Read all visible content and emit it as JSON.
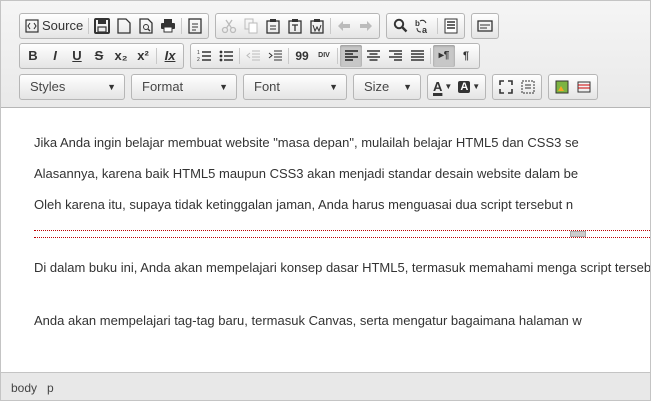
{
  "toolbar": {
    "source_label": "Source",
    "styles_label": "Styles",
    "format_label": "Format",
    "font_label": "Font",
    "size_label": "Size",
    "glyphs": {
      "bold": "B",
      "italic": "I",
      "underline": "U",
      "strike": "S",
      "subscript": "x₂",
      "superscript": "x²",
      "remove_format": "Ix",
      "blockquote": "99",
      "div": "DIV",
      "text_color": "A",
      "bg_color": "A",
      "ltr": "▸¶",
      "rtl": "¶"
    }
  },
  "content": {
    "paragraphs": [
      "Jika Anda ingin belajar membuat website \"masa depan\", mulailah belajar HTML5 dan CSS3 se",
      "Alasannya, karena baik HTML5 maupun CSS3 akan menjadi standar desain website dalam be",
      "Oleh karena itu, supaya tidak ketinggalan jaman, Anda harus menguasai dua script tersebut n",
      "Di dalam buku ini, Anda akan mempelajari konsep dasar HTML5, termasuk memahami menga script tersebut.",
      "Anda akan mempelajari tag-tag baru, termasuk Canvas, serta mengatur bagaimana halaman w"
    ]
  },
  "statusbar": {
    "path": [
      "body",
      "p"
    ]
  }
}
